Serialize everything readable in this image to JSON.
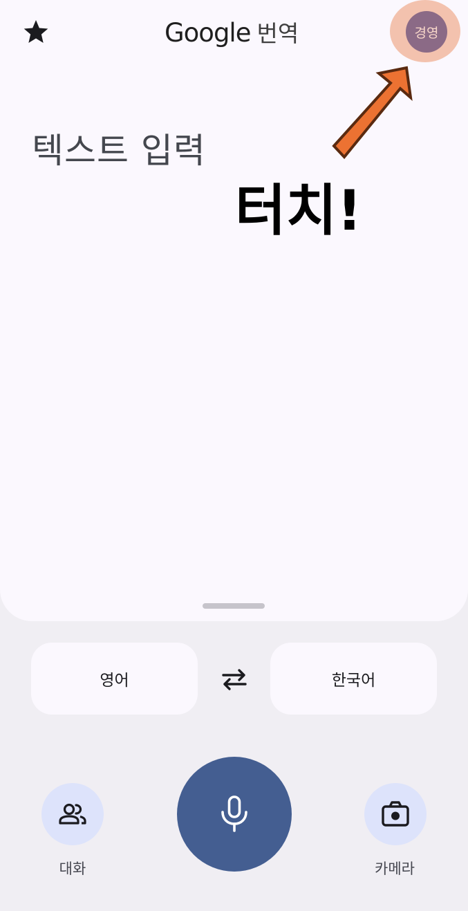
{
  "header": {
    "logo_brand": "Google",
    "logo_product": "번역",
    "avatar_text": "경영",
    "favorites_icon": "star-icon"
  },
  "input": {
    "placeholder": "텍스트 입력"
  },
  "annotation": {
    "text": "터치!",
    "arrow_color": "#ec7232"
  },
  "languages": {
    "source": "영어",
    "target": "한국어",
    "swap_icon": "swap-arrows-icon"
  },
  "bottom_bar": {
    "conversation_label": "대화",
    "camera_label": "카메라",
    "mic_icon": "microphone-icon"
  },
  "colors": {
    "mic_button": "#445e91",
    "side_buttons": "#dde3fb",
    "avatar": "#8b6a86",
    "avatar_highlight": "#f3c2ae"
  }
}
